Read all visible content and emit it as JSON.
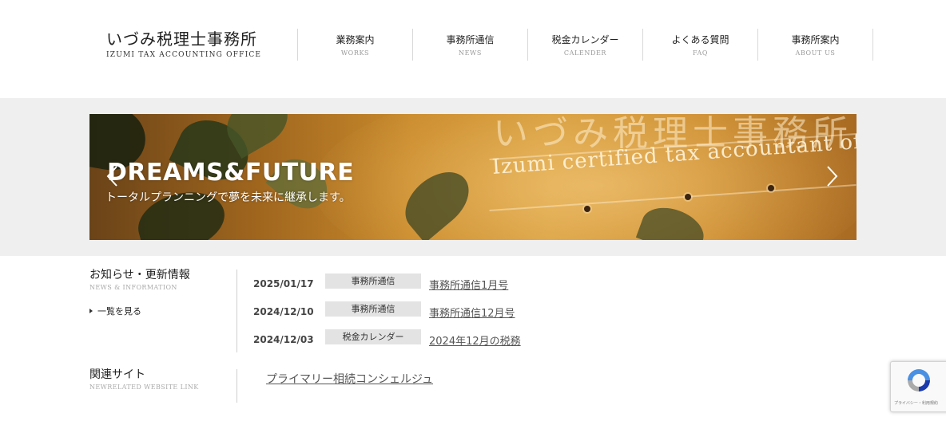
{
  "header": {
    "logo_main": "いづみ税理士事務所",
    "logo_sub": "IZUMI TAX ACCOUNTING OFFICE",
    "nav": [
      {
        "jp": "業務案内",
        "en": "WORKS"
      },
      {
        "jp": "事務所通信",
        "en": "NEWS"
      },
      {
        "jp": "税金カレンダー",
        "en": "CALENDER"
      },
      {
        "jp": "よくある質問",
        "en": "FAQ"
      },
      {
        "jp": "事務所案内",
        "en": "ABOUT US"
      }
    ]
  },
  "banner": {
    "title": "DREAMS&FUTURE",
    "subtitle": "トータルプランニングで夢を未来に継承します。",
    "sign_jp": "いづみ税理士事務所",
    "sign_en": "Izumi certified tax accountant office"
  },
  "news": {
    "title": "お知らせ・更新情報",
    "title_en": "NEWS & INFORMATION",
    "list_link": "一覧を見る",
    "items": [
      {
        "date": "2025/01/17",
        "category": "事務所通信",
        "title": "事務所通信1月号"
      },
      {
        "date": "2024/12/10",
        "category": "事務所通信",
        "title": "事務所通信12月号"
      },
      {
        "date": "2024/12/03",
        "category": "税金カレンダー",
        "title": "2024年12月の税務"
      }
    ]
  },
  "related": {
    "title": "関連サイト",
    "title_en": "NEWRELATED WEBSITE LINK",
    "link": "プライマリー相続コンシェルジュ"
  },
  "recaptcha": {
    "text": "プライバシー・利用規約"
  },
  "colors": {
    "nav_divider": "#d8d8d8",
    "banner_band": "#efefef",
    "category_bg": "#e3e3e3"
  }
}
